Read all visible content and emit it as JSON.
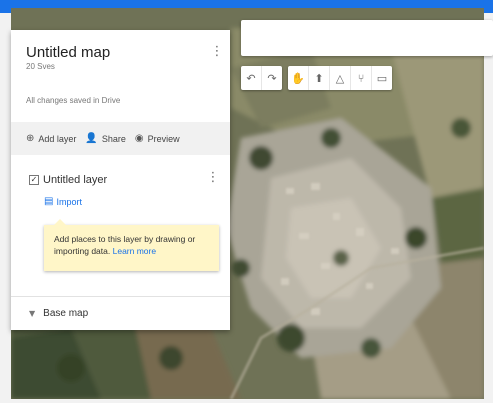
{
  "panel": {
    "title": "Untitled map",
    "subtitle": "20 Sves",
    "saved_status": "All changes saved in Drive",
    "menu_icon": "more-vert-icon",
    "actions": [
      {
        "label": "Add layer",
        "icon": "add-layer-icon"
      },
      {
        "label": "Share",
        "icon": "share-person-icon"
      },
      {
        "label": "Preview",
        "icon": "eye-icon"
      }
    ],
    "layer": {
      "name": "Untitled layer",
      "checked": true,
      "import_label": "Import",
      "menu_icon": "more-vert-icon"
    },
    "tooltip": {
      "text": "Add places to this layer by drawing or importing data.",
      "link": "Learn more"
    },
    "base_map": {
      "label": "Base map",
      "icon": "chevron-down-icon"
    }
  },
  "search": {
    "placeholder": ""
  },
  "toolbar": {
    "groups": [
      [
        "undo-icon",
        "redo-icon"
      ],
      [
        "hand-icon",
        "marker-icon",
        "draw-line-icon",
        "directions-icon",
        "ruler-icon"
      ]
    ]
  },
  "colors": {
    "accent": "#1a73e8",
    "tooltip_bg": "#fff6c8",
    "map_bg": "#6e7156"
  }
}
